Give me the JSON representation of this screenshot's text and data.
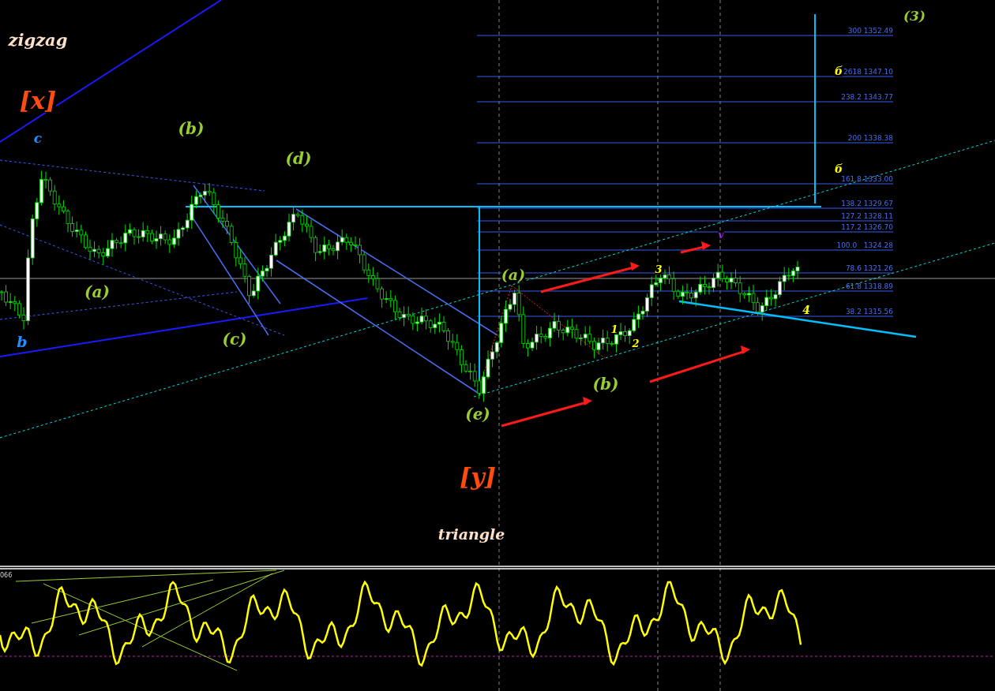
{
  "chart": {
    "wave_labels": [
      {
        "text": "zigzag",
        "color": "#ffe0c8"
      },
      {
        "text": "[x]",
        "color": "#ff4a10"
      },
      {
        "text": "c",
        "color": "#1e90ff"
      },
      {
        "text": "(b)",
        "color": "#9acd32"
      },
      {
        "text": "(d)",
        "color": "#9acd32"
      },
      {
        "text": "(a)",
        "color": "#9acd32"
      },
      {
        "text": "b",
        "color": "#1e90ff"
      },
      {
        "text": "(c)",
        "color": "#9acd32"
      },
      {
        "text": "(a)",
        "color": "#9acd32"
      },
      {
        "text": "3",
        "color": "#ffff00"
      },
      {
        "text": "1",
        "color": "#ffff00"
      },
      {
        "text": "2",
        "color": "#ffff00"
      },
      {
        "text": "(b)",
        "color": "#9acd32"
      },
      {
        "text": "(e)",
        "color": "#9acd32"
      },
      {
        "text": "[y]",
        "color": "#ff4a10"
      },
      {
        "text": "triangle",
        "color": "#ffe0c8"
      },
      {
        "text": "4",
        "color": "#ffff00"
      },
      {
        "text": "(3)",
        "color": "#9acd32"
      }
    ],
    "fib_levels": [
      {
        "text": "300 1352.49"
      },
      {
        "text": "2618 1347.10"
      },
      {
        "text": "238.2 1343.77"
      },
      {
        "text": "200 1338.38"
      },
      {
        "text": "161.8 1333.00"
      },
      {
        "text": "138.2 1329.67"
      },
      {
        "text": "127.2 1328.11"
      },
      {
        "text": "117.2 1326.70"
      },
      {
        "text": "100.0   1324.28"
      },
      {
        "text": "78.6 1321.26"
      },
      {
        "text": "61.8 1318.89"
      },
      {
        "text": "38.2 1315.56"
      }
    ],
    "markers": [
      {
        "text": "б",
        "color": "#ffff00"
      },
      {
        "text": "б",
        "color": "#ffff00"
      },
      {
        "text": "v",
        "color": "#a020f0"
      }
    ],
    "oscillator": {
      "label": "066"
    }
  }
}
